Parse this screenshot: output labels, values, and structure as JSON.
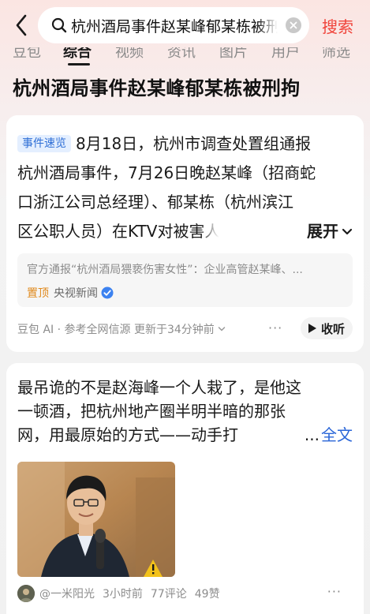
{
  "search": {
    "query": "杭州酒局事件赵某峰郁某栋被刑拘",
    "submit_label": "搜索"
  },
  "tabs": [
    "豆包",
    "综合",
    "视频",
    "资讯",
    "图片",
    "用户",
    "筛选"
  ],
  "active_tab": "综合",
  "heading": "杭州酒局事件赵某峰郁某栋被刑拘",
  "summary_card": {
    "badge": "事件速览",
    "lines": [
      "8月18日，杭州市调查处置组通报",
      "杭州酒局事件，7月26日晚赵某峰（招商蛇",
      "口浙江公司总经理）、郁某栋（杭州滨江",
      "区公职人员）在KTV对被害人实施"
    ],
    "expand_label": "展开",
    "source_title": "官方通报“杭州酒局猥亵伤害女性”：企业高管赵某峰、...",
    "pin_label": "置顶",
    "source_name": "央视新闻",
    "ai_note": "豆包 AI · 参考全网信源 更新于34分钟前",
    "listen_label": "收听"
  },
  "article_card": {
    "lines": [
      "最吊诡的不是赵海峰一个人栽了，是他这",
      "一顿酒，把杭州地产圈半明半暗的那张",
      "网，用最原始的方式——动手打"
    ],
    "ellipsis": "...",
    "fulltext_label": "全文",
    "author": "@一米阳光",
    "time": "3小时前",
    "comments": "77评论",
    "likes": "49赞"
  },
  "colors": {
    "accent_red": "#f0433a",
    "link_blue": "#2a66d8",
    "badge_blue": "#2f6fd6",
    "pin_orange": "#e08a1e"
  }
}
